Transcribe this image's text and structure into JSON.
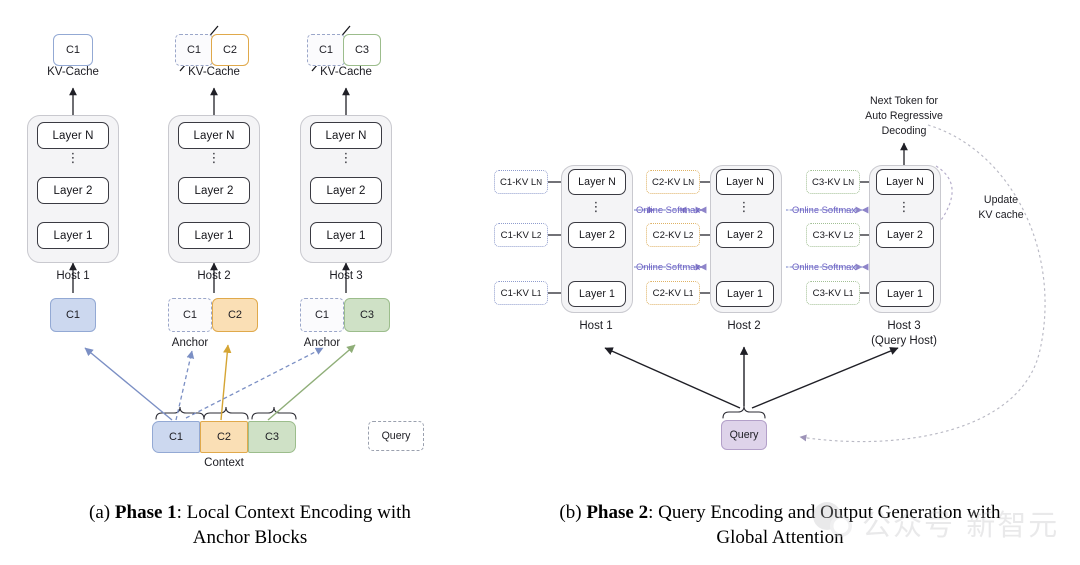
{
  "panel_a": {
    "kv_cache_label": "KV-Cache",
    "anchor_label": "Anchor",
    "context_label": "Context",
    "query_label": "Query",
    "kv_caches": [
      {
        "ghost": null,
        "chip": "C1"
      },
      {
        "ghost": "C1",
        "chip": "C2"
      },
      {
        "ghost": "C1",
        "chip": "C3"
      }
    ],
    "hosts": [
      {
        "name": "Host 1",
        "layers": [
          "Layer N",
          "Layer 2",
          "Layer 1"
        ]
      },
      {
        "name": "Host 2",
        "layers": [
          "Layer N",
          "Layer 2",
          "Layer 1"
        ]
      },
      {
        "name": "Host 3",
        "layers": [
          "Layer N",
          "Layer 2",
          "Layer 1"
        ]
      }
    ],
    "inputs": [
      {
        "ghost": null,
        "chip": "C1",
        "anchor": false
      },
      {
        "ghost": "C1",
        "chip": "C2",
        "anchor": true
      },
      {
        "ghost": "C1",
        "chip": "C3",
        "anchor": true
      }
    ],
    "context_blocks": [
      "C1",
      "C2",
      "C3"
    ]
  },
  "panel_b": {
    "next_token_label_l1": "Next Token for",
    "next_token_label_l2": "Auto Regressive",
    "next_token_label_l3": "Decoding",
    "update_kv_l1": "Update",
    "update_kv_l2": "KV cache",
    "softmax_label": "Online Softmax",
    "query_label": "Query",
    "hosts": [
      {
        "name": "Host 1",
        "sub": "",
        "layers": [
          "Layer N",
          "Layer 2",
          "Layer 1"
        ],
        "kv": [
          "C1-KV L",
          "C1-KV L",
          "C1-KV L"
        ],
        "kv_sub": [
          "N",
          "2",
          "1"
        ]
      },
      {
        "name": "Host 2",
        "sub": "",
        "layers": [
          "Layer N",
          "Layer 2",
          "Layer 1"
        ],
        "kv": [
          "C2-KV L",
          "C2-KV L",
          "C2-KV L"
        ],
        "kv_sub": [
          "N",
          "2",
          "1"
        ]
      },
      {
        "name": "Host 3",
        "sub": "(Query Host)",
        "layers": [
          "Layer N",
          "Layer 2",
          "Layer 1"
        ],
        "kv": [
          "C3-KV L",
          "C3-KV L",
          "C3-KV L"
        ],
        "kv_sub": [
          "N",
          "2",
          "1"
        ]
      }
    ]
  },
  "captions": {
    "a_prefix": "(a) ",
    "a_bold": "Phase 1",
    "a_rest": ": Local Context Encoding with",
    "a_line2": "Anchor Blocks",
    "b_prefix": "(b) ",
    "b_bold": "Phase 2",
    "b_rest": ": Query Encoding and Output Generation with",
    "b_line2": "Global Attention"
  },
  "watermark": {
    "text": "公众号  新智元"
  },
  "colors": {
    "c1": "#ccd8ef",
    "c2": "#fadfb5",
    "c3": "#cfe1c6",
    "query": "#ded3ea",
    "softmax_text": "#6b5fc4",
    "arrow_c1": "#7b8fc4",
    "arrow_c2": "#d5a534",
    "arrow_c3": "#8fae78",
    "dashed_gray": "#b9b9c4"
  }
}
